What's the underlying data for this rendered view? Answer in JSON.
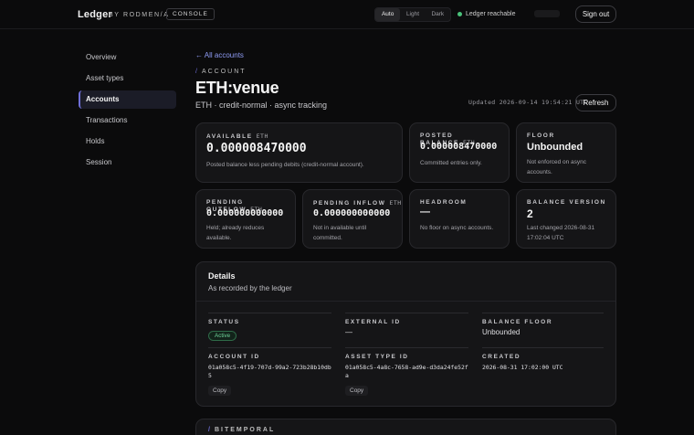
{
  "app": {
    "brand": "Ledger",
    "brand_sub": "BY RODMEN/A",
    "console_label": "CONSOLE"
  },
  "theme": {
    "options": [
      "Auto",
      "Light",
      "Dark"
    ],
    "selected": "Auto"
  },
  "status": {
    "label": "Ledger reachable",
    "color": "#4ac27a"
  },
  "header_buttons": {
    "sign_out": "Sign out",
    "refresh": "Refresh"
  },
  "sidebar": {
    "items": [
      {
        "label": "Overview",
        "active": false
      },
      {
        "label": "Asset types",
        "active": false
      },
      {
        "label": "Accounts",
        "active": true
      },
      {
        "label": "Transactions",
        "active": false
      },
      {
        "label": "Holds",
        "active": false
      },
      {
        "label": "Session",
        "active": false
      }
    ]
  },
  "page": {
    "back_link": "← All accounts",
    "eyebrow": "ACCOUNT",
    "title": "ETH:venue",
    "subtitle": "ETH · credit-normal · async tracking",
    "updated": "Updated 2026-09-14 19:54:21 UTC"
  },
  "cards": {
    "available": {
      "label": "AVAILABLE",
      "unit": "ETH",
      "value": "0.000008470000",
      "note": "Posted balance less pending debits (credit-normal account)."
    },
    "posted": {
      "label": "POSTED BALANCE",
      "unit": "ETH",
      "value": "0.000008470000",
      "note": "Committed entries only."
    },
    "floor": {
      "label": "FLOOR",
      "value": "Unbounded",
      "note": "Not enforced on async accounts."
    },
    "pending_outflow": {
      "label": "PENDING OUTFLOW",
      "unit": "ETH",
      "value": "0.000000000000",
      "note": "Held; already reduces available."
    },
    "pending_inflow": {
      "label": "PENDING INFLOW",
      "unit": "ETH",
      "value": "0.000000000000",
      "note": "Not in available until committed."
    },
    "headroom": {
      "label": "HEADROOM",
      "value": "—",
      "note": "No floor on async accounts."
    },
    "balance_version": {
      "label": "BALANCE VERSION",
      "value": "2",
      "note": "Last changed 2026-08-31 17:02:04 UTC"
    }
  },
  "details": {
    "title": "Details",
    "subtitle": "As recorded by the ledger",
    "status_label": "STATUS",
    "status_value": "Active",
    "external_id_label": "EXTERNAL ID",
    "external_id_value": "—",
    "balance_floor_label": "BALANCE FLOOR",
    "balance_floor_value": "Unbounded",
    "account_id_label": "ACCOUNT ID",
    "account_id_value": "01a058c5-4f19-707d-99a2-723b28b10db5",
    "asset_type_id_label": "ASSET TYPE ID",
    "asset_type_id_value": "01a058c5-4a8c-7658-ad9e-d3da24fe52fa",
    "created_label": "CREATED",
    "created_value": "2026-08-31 17:02:00 UTC",
    "copy_label": "Copy"
  },
  "bitemporal": {
    "eyebrow": "BITEMPORAL"
  }
}
